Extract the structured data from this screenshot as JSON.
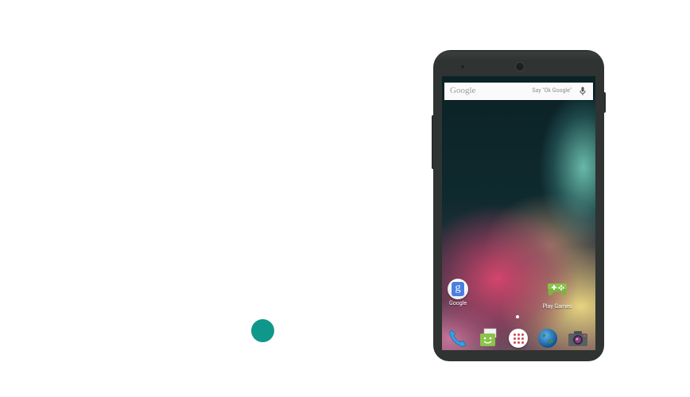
{
  "search": {
    "logo": "Google",
    "hint": "Say \"Ok Google\""
  },
  "home_apps": [
    {
      "label": "Google",
      "icon": "google-search-icon"
    },
    {
      "label": "Play Games",
      "icon": "gamepad-icon"
    }
  ],
  "dock": [
    {
      "icon": "phone-icon"
    },
    {
      "icon": "messenger-icon"
    },
    {
      "icon": "all-apps-icon"
    },
    {
      "icon": "browser-globe-icon"
    },
    {
      "icon": "camera-icon"
    }
  ],
  "colors": {
    "touch_indicator": "#0f978a",
    "phone_body": "#2f3331",
    "search_bar": "#fafafa"
  }
}
